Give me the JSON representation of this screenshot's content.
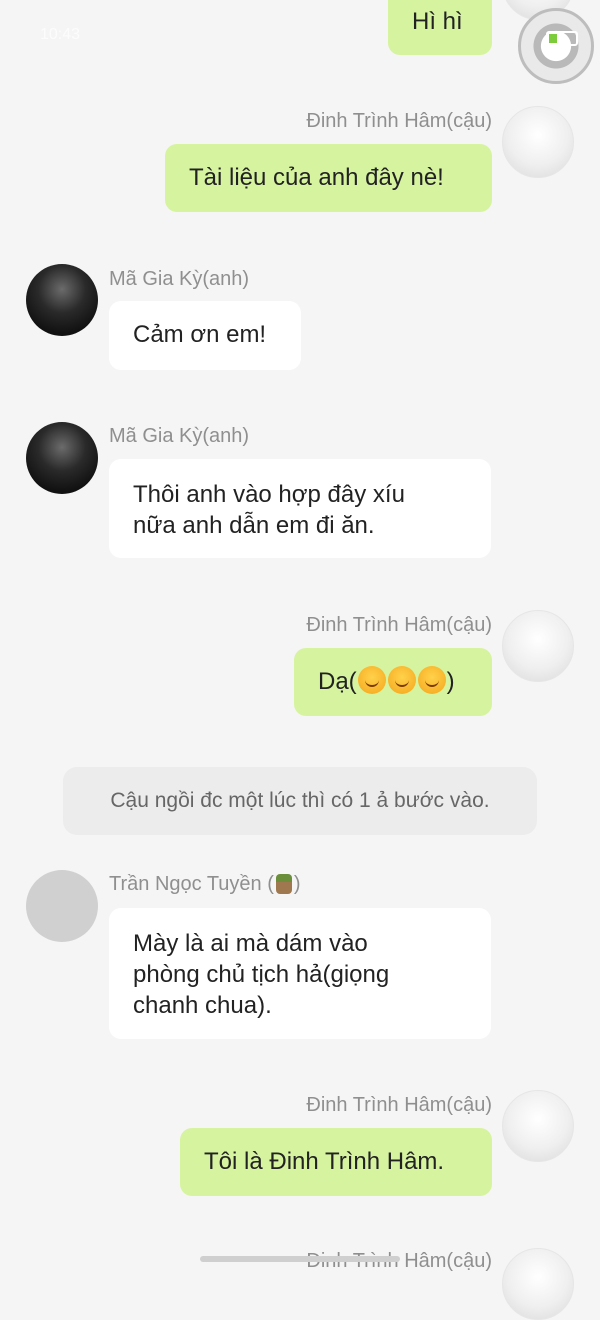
{
  "status_bar": {
    "time": "10:43"
  },
  "messages": [
    {
      "id": "m0",
      "side": "right",
      "name": "",
      "text": "Hì hì"
    },
    {
      "id": "m1",
      "side": "right",
      "name": "Đinh Trình Hâm(cậu)",
      "text": "Tài liệu của anh đây nè!"
    },
    {
      "id": "m2",
      "side": "left",
      "name": "Mã Gia Kỳ(anh)",
      "text": "Cảm ơn em!"
    },
    {
      "id": "m3",
      "side": "left",
      "name": "Mã Gia Kỳ(anh)",
      "line1": "Thôi anh vào hợp đây xíu",
      "line2": "nữa anh dẫn em đi ăn."
    },
    {
      "id": "m4",
      "side": "right",
      "name": "Đinh Trình Hâm(cậu)",
      "prefix": "Dạ(",
      "suffix": ")",
      "emoji_count": 3
    },
    {
      "id": "m5",
      "side": "left",
      "name_prefix": "Trần Ngọc Tuyền (",
      "name_suffix": ")",
      "line1": "Mày là ai mà dám vào",
      "line2": "phòng chủ tịch hả(giọng",
      "line3": "chanh chua)."
    },
    {
      "id": "m6",
      "side": "right",
      "name": "Đinh Trình Hâm(cậu)",
      "text": "Tôi là Đinh Trình Hâm."
    },
    {
      "id": "m7",
      "side": "right",
      "name": "Đinh Trình Hâm(cậu)"
    }
  ],
  "system_message": "Cậu ngồi đc một lúc thì có 1 ả bước vào.",
  "colors": {
    "my_bubble": "#d6f3a0",
    "their_bubble": "#ffffff",
    "background": "#f5f5f5",
    "name": "#8f8f8f"
  },
  "icons": [
    "battery-icon",
    "signal-icon",
    "floating-assistive-button",
    "emoji-smile-icon",
    "cactus-emoji-icon"
  ]
}
